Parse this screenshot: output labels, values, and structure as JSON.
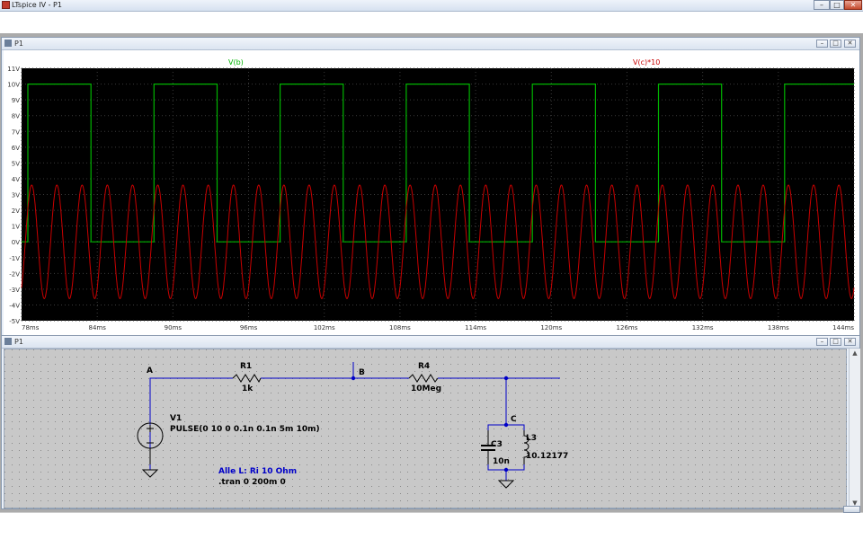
{
  "app": {
    "title": "LTspice IV - P1"
  },
  "window_controls": {
    "minimize": "–",
    "maximize": "□",
    "close": "✕"
  },
  "plot_window": {
    "title": "P1",
    "trace_labels": [
      "V(b)",
      "V(c)*10"
    ],
    "trace_colors": [
      "#00b400",
      "#c80000"
    ],
    "y_ticks": [
      "11V",
      "10V",
      "9V",
      "8V",
      "7V",
      "6V",
      "5V",
      "4V",
      "3V",
      "2V",
      "1V",
      "0V",
      "-1V",
      "-2V",
      "-3V",
      "-4V",
      "-5V"
    ],
    "x_ticks": [
      "78ms",
      "84ms",
      "90ms",
      "96ms",
      "102ms",
      "108ms",
      "114ms",
      "120ms",
      "126ms",
      "132ms",
      "138ms",
      "144ms"
    ]
  },
  "schematic_window": {
    "title": "P1",
    "nodes": {
      "a": "A",
      "b": "B",
      "c": "C"
    },
    "r1": {
      "name": "R1",
      "value": "1k"
    },
    "r4": {
      "name": "R4",
      "value": "10Meg"
    },
    "v1": {
      "name": "V1",
      "value": "PULSE(0 10 0 0.1n 0.1n 5m 10m)"
    },
    "c3": {
      "name": "C3",
      "value": "10n"
    },
    "l3": {
      "name": "L3",
      "value": "10.12177"
    },
    "comment": "Alle L: Ri 10 Ohm",
    "directive": ".tran 0 200m 0"
  },
  "chart_data": {
    "type": "line",
    "xlabel": "",
    "ylabel": "",
    "xlim": [
      78,
      144
    ],
    "ylim": [
      -5,
      11
    ],
    "grid": true,
    "series": [
      {
        "name": "V(b)",
        "color": "#00b400",
        "x": [
          78,
          78.5,
          78.5,
          83.5,
          83.5,
          88.5,
          88.5,
          93.5,
          93.5,
          98.5,
          98.5,
          103.5,
          103.5,
          108.5,
          108.5,
          113.5,
          113.5,
          118.5,
          118.5,
          123.5,
          123.5,
          128.5,
          128.5,
          133.5,
          133.5,
          138.5,
          138.5,
          144
        ],
        "y": [
          0,
          0,
          10,
          10,
          0,
          0,
          10,
          10,
          0,
          0,
          10,
          10,
          0,
          0,
          10,
          10,
          0,
          0,
          10,
          10,
          0,
          0,
          10,
          10,
          0,
          0,
          10,
          10
        ]
      },
      {
        "name": "V(c)*10",
        "color": "#c80000",
        "amplitude": 3.6,
        "period": 2.0,
        "start_peak": 78.8,
        "x_range": [
          78,
          144
        ]
      }
    ]
  }
}
